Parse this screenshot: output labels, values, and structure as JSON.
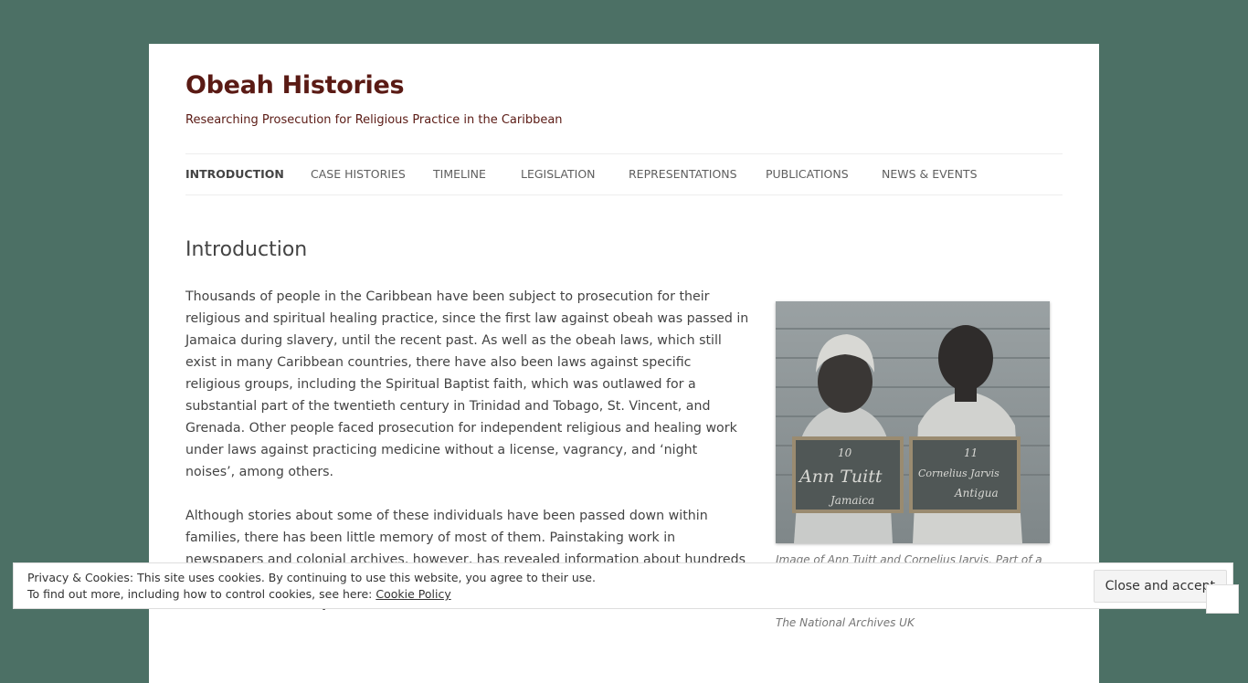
{
  "site": {
    "title": "Obeah Histories",
    "description": "Researching Prosecution for Religious Practice in the Caribbean"
  },
  "nav": {
    "items": [
      {
        "label": "Introduction",
        "active": true
      },
      {
        "label": "Case Histories",
        "active": false
      },
      {
        "label": "Timeline",
        "active": false
      },
      {
        "label": "Legislation",
        "active": false
      },
      {
        "label": "Representations",
        "active": false
      },
      {
        "label": "Publications",
        "active": false
      },
      {
        "label": "News & Events",
        "active": false
      }
    ]
  },
  "main": {
    "heading": "Introduction",
    "paragraphs": [
      "Thousands of people in the Caribbean have been subject to prosecution for their religious and  spiritual healing practice, since the first law against obeah was passed in Jamaica during slav­ery, until the recent past. As well as the obeah laws, which still exist in many Caribbean coun­tries, there have also been laws against specific religious groups, including the Spiritual Baptist faith, which was outlawed for a substantial part of the twentieth century in Trinidad and Tobago, St. Vincent, and Grenada. Other people faced prosecution for independent religious and healing work under laws against practicing medicine without a license, vagrancy, and ‘night noises’, among others.",
      "Although stories about some of these individuals have been passed down within families, there has been little memory of most of them. Painstaking work in newspapers and colonial archives, however, has revealed information about hundreds of people who were prosecuted for crimes relating to religion between the eighteenth and twentieth century. This website tells"
    ]
  },
  "figure": {
    "caption": "Image of Ann Tuitt and Cornelius Jarvis. Part of a larger",
    "caption_tail": "The National Archives UK",
    "slate_left": {
      "number": "10",
      "name": "Ann Tuitt",
      "place": "Jamaica"
    },
    "slate_right": {
      "number": "11",
      "name": "Cornelius Jarvis",
      "place": "Antigua"
    }
  },
  "cookie": {
    "line1": "Privacy & Cookies: This site uses cookies. By continuing to use this website, you agree to their use.",
    "line2_prefix": "To find out more, including how to control cookies, see here: ",
    "link_label": "Cookie Policy",
    "button_label": "Close and accept"
  },
  "colors": {
    "background": "#4c7065",
    "title": "#5a1a14"
  }
}
